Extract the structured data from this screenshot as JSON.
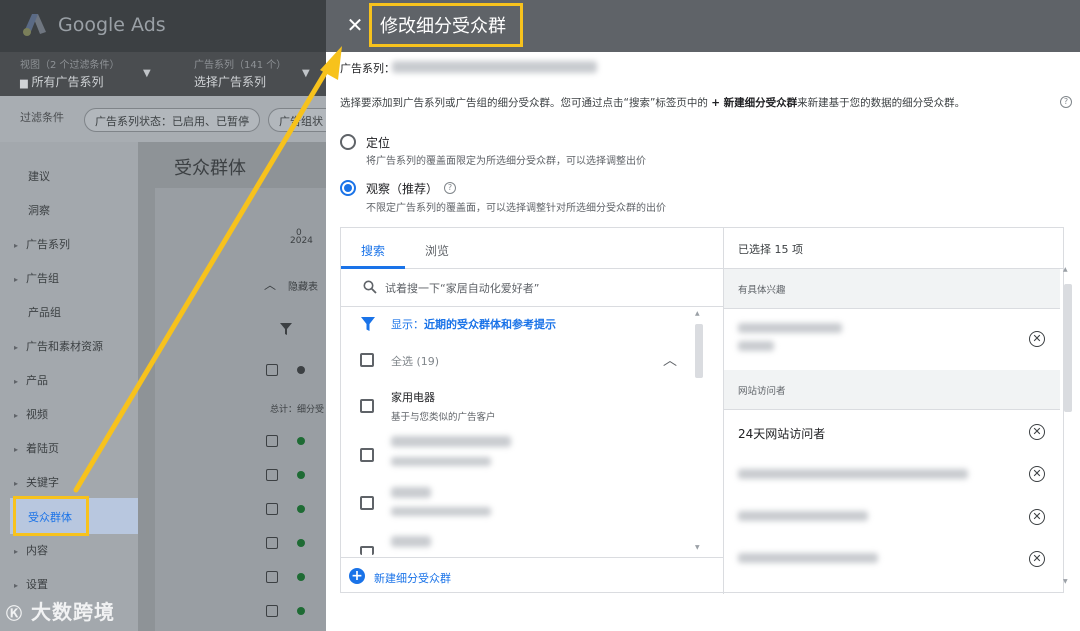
{
  "background_app": {
    "brand": "Google Ads",
    "view_label": "视图（2 个过滤条件）",
    "view_value": "所有广告系列",
    "campaign_label": "广告系列（141 个）",
    "campaign_value": "选择广告系列",
    "filter_label": "过滤条件",
    "filter_chip": "广告系列状态：已启用、已暂停",
    "filter_chip_2": "广告组状",
    "main_title": "受众群体",
    "sidebar": [
      {
        "label": "建议",
        "expandable": false
      },
      {
        "label": "洞察",
        "expandable": false
      },
      {
        "label": "广告系列",
        "expandable": true
      },
      {
        "label": "广告组",
        "expandable": true
      },
      {
        "label": "产品组",
        "expandable": false
      },
      {
        "label": "广告和素材资源",
        "expandable": true
      },
      {
        "label": "产品",
        "expandable": true
      },
      {
        "label": "视频",
        "expandable": true
      },
      {
        "label": "着陆页",
        "expandable": true
      },
      {
        "label": "关键字",
        "expandable": true
      },
      {
        "label": "受众群体",
        "expandable": false,
        "active": true
      },
      {
        "label": "内容",
        "expandable": true
      },
      {
        "label": "设置",
        "expandable": true
      }
    ],
    "chart_zero": "0",
    "chart_year": "2024",
    "collapse_label": "隐藏表",
    "total_label": "总计：细分受"
  },
  "dialog": {
    "title": "修改细分受众群",
    "campaign_label": "广告系列：",
    "intro_pre": "选择要添加到广告系列或广告组的细分受众群。您可通过点击“搜索”标签页中的 ",
    "intro_bold": "+ 新建细分受众群",
    "intro_post": "来新建基于您的数据的细分受众群。",
    "targeting": {
      "title": "定位",
      "desc": "将广告系列的覆盖面限定为所选细分受众群，可以选择调整出价",
      "selected": false
    },
    "observation": {
      "title": "观察（推荐）",
      "desc": "不限定广告系列的覆盖面，可以选择调整针对所选细分受众群的出价",
      "selected": true
    },
    "tabs": [
      {
        "label": "搜索",
        "active": true
      },
      {
        "label": "浏览",
        "active": false
      }
    ],
    "search_placeholder": "试着搜一下“家居自动化爱好者”",
    "show_label": "显示：",
    "show_value": "近期的受众群体和参考提示",
    "select_all": "全选 (19)",
    "first_item_title": "家用电器",
    "first_item_sub": "基于与您类似的广告客户",
    "new_segment": "新建细分受众群",
    "selected_count": "已选择 15 项",
    "group_interest": "有具体兴趣",
    "group_visitors": "网站访问者",
    "visitor_item": "24天网站访问者"
  },
  "watermark": "大数跨境",
  "colors": {
    "accent": "#1a73e8",
    "highlight": "#f7c21c",
    "header": "#5f6368"
  }
}
